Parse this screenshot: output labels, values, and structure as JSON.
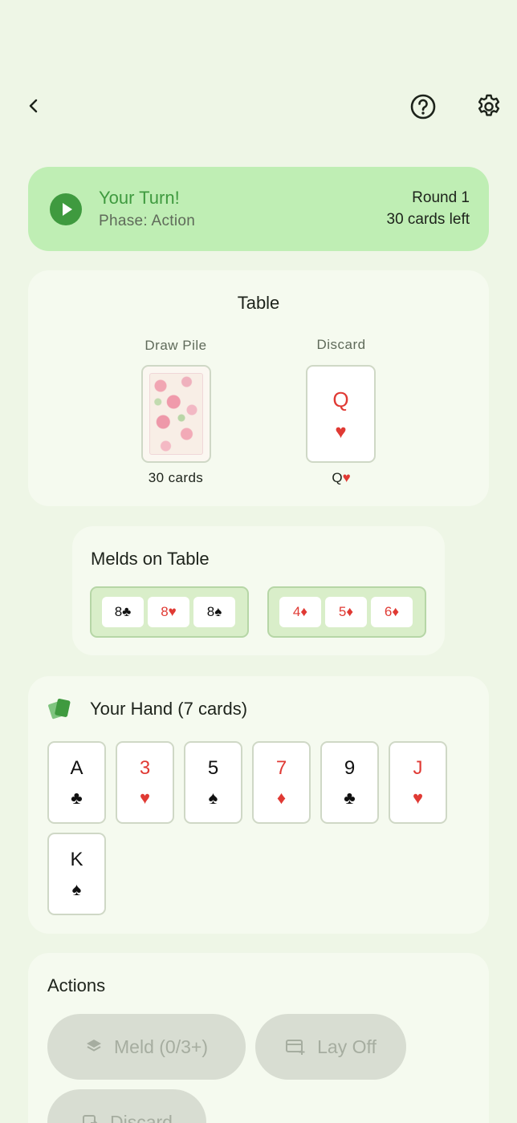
{
  "topbar": {
    "back_icon": "chevron-left-icon",
    "help_icon": "help-circle-icon",
    "settings_icon": "gear-icon"
  },
  "status": {
    "title": "Your Turn!",
    "phase": "Phase: Action",
    "round": "Round 1",
    "cards_left": "30 cards left",
    "accent_color": "#3f9a3f",
    "banner_color": "#bfeeb4"
  },
  "table": {
    "title": "Table",
    "draw_label": "Draw Pile",
    "draw_count": "30 cards",
    "discard_label": "Discard",
    "discard_rank": "Q",
    "discard_suit": "♥",
    "discard_caption_rank": "Q",
    "discard_caption_suit": "♥"
  },
  "melds": {
    "title": "Melds on Table",
    "groups": [
      {
        "cards": [
          {
            "label": "8♣",
            "color": "black"
          },
          {
            "label": "8♥",
            "color": "red"
          },
          {
            "label": "8♠",
            "color": "black"
          }
        ]
      },
      {
        "cards": [
          {
            "label": "4♦",
            "color": "red"
          },
          {
            "label": "5♦",
            "color": "red"
          },
          {
            "label": "6♦",
            "color": "red"
          }
        ]
      }
    ]
  },
  "hand": {
    "title": "Your Hand (7 cards)",
    "cards": [
      {
        "rank": "A",
        "suit": "♣",
        "color": "black"
      },
      {
        "rank": "3",
        "suit": "♥",
        "color": "red"
      },
      {
        "rank": "5",
        "suit": "♠",
        "color": "black"
      },
      {
        "rank": "7",
        "suit": "♦",
        "color": "red"
      },
      {
        "rank": "9",
        "suit": "♣",
        "color": "black"
      },
      {
        "rank": "J",
        "suit": "♥",
        "color": "red"
      },
      {
        "rank": "K",
        "suit": "♠",
        "color": "black"
      }
    ]
  },
  "actions": {
    "title": "Actions",
    "meld_label": "Meld (0/3+)",
    "layoff_label": "Lay Off",
    "discard_label": "Discard"
  }
}
